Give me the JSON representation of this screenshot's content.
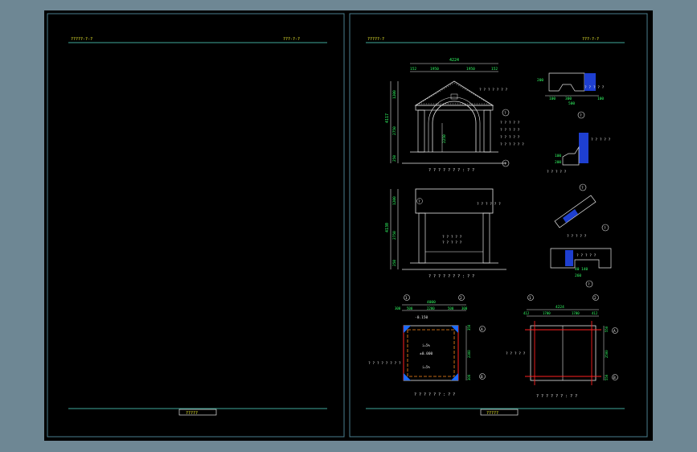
{
  "window": {
    "background_color": "#6e8794",
    "canvas_color": "#000000",
    "frame_color": "#4a7e8e",
    "text_color_white": "#e6e6e6",
    "text_color_yellow": "#ffff33",
    "text_color_green": "#33ff66"
  },
  "left_sheet": {
    "header_left": "?????-?-?",
    "header_right": "???-?-?",
    "title_block": "?????"
  },
  "right_sheet": {
    "header_left": "?????-?",
    "header_right": "???-?-?",
    "title_block": "?????",
    "front_elevation": {
      "dim_total": "4224",
      "dim_parts": [
        "152",
        "1950",
        "1950",
        "152"
      ],
      "dim_height_total": "4117",
      "dim_heights": [
        "1200",
        "2750",
        "250"
      ],
      "arch_height": "2250",
      "caption": "? ? ? ? ? ? ? : ? ?",
      "callouts": [
        "? ? ? ? ? ? ?",
        "? ? ? ? ?",
        "? ? ? ? ?",
        "? ? ? ? ?",
        "? ? ? ? ? ?"
      ],
      "circle_labels": [
        "?",
        "?"
      ]
    },
    "side_elevation": {
      "dim_height_total": "4130",
      "dim_heights": [
        "1200",
        "2750",
        "250"
      ],
      "caption": "? ? ? ? ? ? ? : ? ?",
      "callouts": [
        "? ? ? ? ? ?",
        "? ? ? ? ?",
        "? ? ? ? ?"
      ],
      "circle_label": "?"
    },
    "detail_1": {
      "dims": [
        "200",
        "100",
        "300",
        "100",
        "500"
      ],
      "callout": "? ? ? ? ?",
      "circle_label": "?"
    },
    "detail_2": {
      "dims": [
        "100",
        "200"
      ],
      "callouts": [
        "? ? ? ? ?",
        "? ? ? ? ?"
      ],
      "circle_label": "?"
    },
    "detail_3": {
      "callout": "? ? ? ? ?",
      "circle_label": "?"
    },
    "detail_4": {
      "dims": [
        "260",
        "40 140"
      ],
      "callout": "? ? ? ? ?",
      "circle_label": "?"
    },
    "plan_left": {
      "dim_total": "4000",
      "dim_parts": [
        "300",
        "500",
        "2200",
        "500",
        "300"
      ],
      "dim_side": [
        "350",
        "2300",
        "300"
      ],
      "level_top": "-0.150",
      "level_center": "±0.000",
      "marks": [
        "i=5%",
        "i=5%"
      ],
      "note": "? ? ? ? ? ? ? ?",
      "caption": "? ? ? ? ? ? : ? ?",
      "axis_top": [
        "1",
        "2"
      ],
      "axis_side": [
        "A",
        "B"
      ]
    },
    "plan_right": {
      "dim_total": "4224",
      "dim_parts": [
        "412",
        "1700",
        "1700",
        "412"
      ],
      "dim_side": [
        "550",
        "2500",
        "550"
      ],
      "callout": "? ? ? ? ?",
      "caption": "? ? ? ? ? ? : ? ?",
      "axis_top": [
        "1",
        "2"
      ],
      "axis_side": [
        "A",
        "B"
      ]
    }
  }
}
